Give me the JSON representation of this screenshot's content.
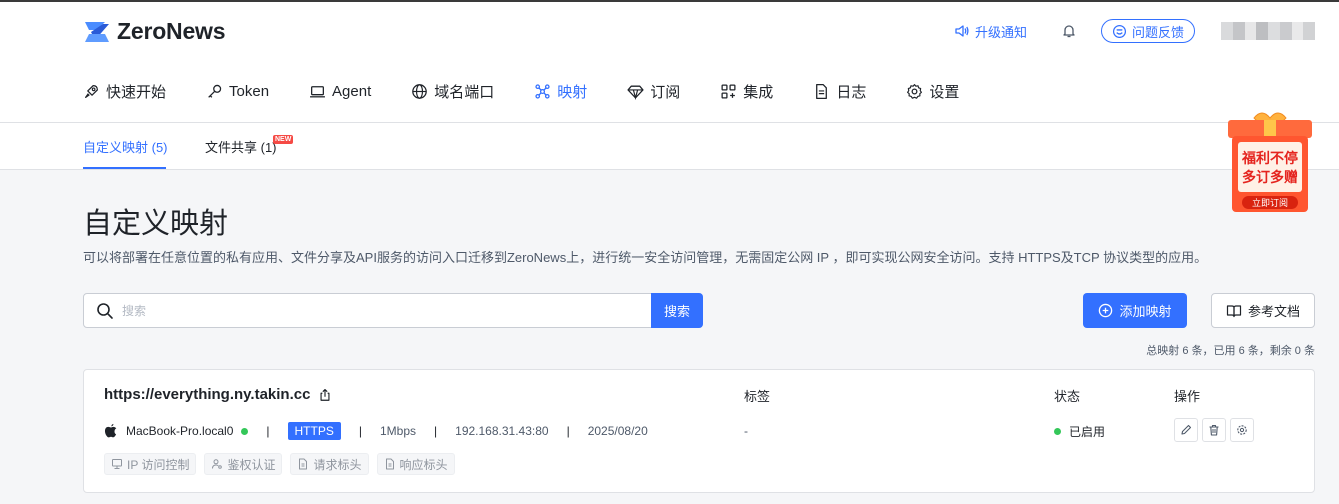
{
  "app": {
    "name": "ZeroNews",
    "upgrade_label": "升级通知",
    "feedback_label": "问题反馈"
  },
  "nav": {
    "items": [
      {
        "label": "快速开始",
        "icon": "rocket-icon"
      },
      {
        "label": "Token",
        "icon": "key-icon"
      },
      {
        "label": "Agent",
        "icon": "laptop-icon"
      },
      {
        "label": "域名端口",
        "icon": "globe-icon"
      },
      {
        "label": "映射",
        "icon": "network-icon",
        "active": true
      },
      {
        "label": "订阅",
        "icon": "diamond-icon"
      },
      {
        "label": "集成",
        "icon": "grid-icon"
      },
      {
        "label": "日志",
        "icon": "document-icon"
      },
      {
        "label": "设置",
        "icon": "gear-icon"
      }
    ]
  },
  "subtabs": {
    "custom_label": "自定义映射 (5)",
    "share_label": "文件共享 (1)",
    "new_badge": "NEW"
  },
  "promo": {
    "line1": "福利不停",
    "line2": "多订多赠",
    "button": "立即订阅"
  },
  "page": {
    "title": "自定义映射",
    "description": "可以将部署在任意位置的私有应用、文件分享及API服务的访问入口迁移到ZeroNews上，进行统一安全访问管理，无需固定公网 IP ，即可实现公网安全访问。支持 HTTPS及TCP 协议类型的应用。"
  },
  "search": {
    "placeholder": "搜索",
    "button_label": "搜索"
  },
  "actions": {
    "add_label": "添加映射",
    "docs_label": "参考文档"
  },
  "summary": "总映射 6 条，已用 6 条，剩余 0 条",
  "table": {
    "col_tags": "标签",
    "col_status": "状态",
    "col_ops": "操作"
  },
  "mapping": {
    "url": "https://everything.ny.takin.cc",
    "device": "MacBook-Pro.local0",
    "protocol": "HTTPS",
    "bandwidth": "1Mbps",
    "target": "192.168.31.43:80",
    "date": "2025/08/20",
    "tags": "-",
    "status": "已启用",
    "chips": [
      "IP 访问控制",
      "鉴权认证",
      "请求标头",
      "响应标头"
    ]
  },
  "colors": {
    "accent": "#3370ff",
    "status_green": "#34c759"
  }
}
